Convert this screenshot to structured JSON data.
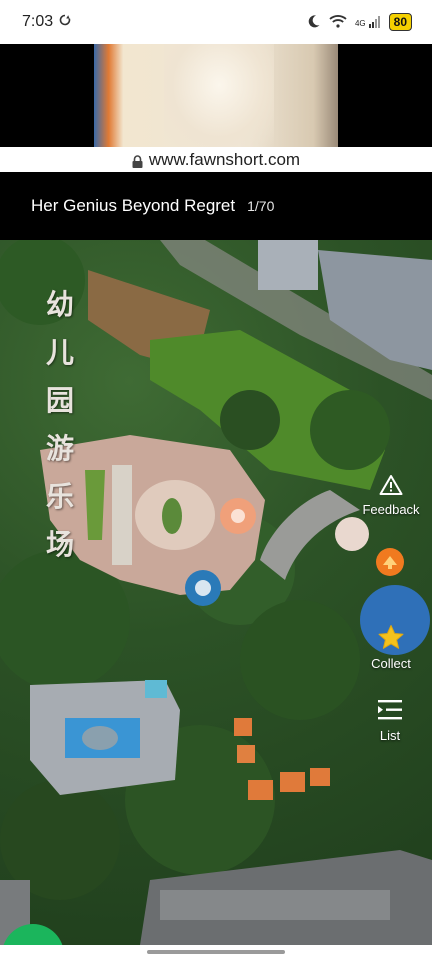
{
  "status_bar": {
    "time": "7:03",
    "network_label": "4G",
    "battery": "80"
  },
  "url_bar": {
    "url": "www.fawnshort.com"
  },
  "title_bar": {
    "title": "Her Genius Beyond Regret",
    "episode": "1/70"
  },
  "video": {
    "sign_chars": [
      "幼",
      "儿",
      "园",
      "游",
      "乐",
      "场"
    ]
  },
  "actions": {
    "feedback_label": "Feedback",
    "collect_label": "Collect",
    "list_label": "List"
  },
  "colors": {
    "battery": "#f4d000",
    "fab": "#1bb55c",
    "share": "#f07a1f",
    "collect_star": "#f4c21c"
  }
}
